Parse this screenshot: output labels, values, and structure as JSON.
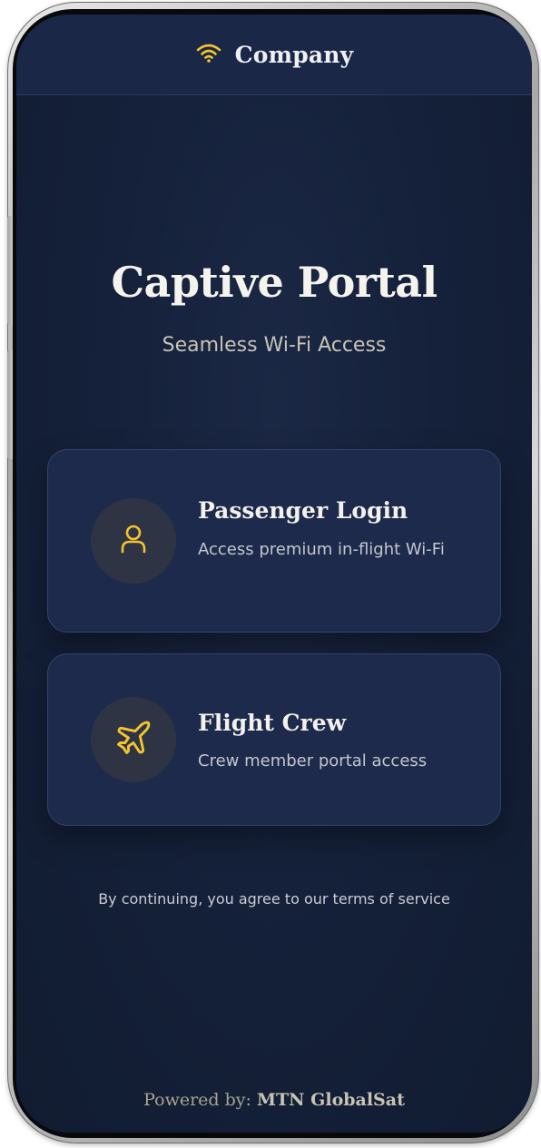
{
  "header": {
    "brand": "Company",
    "icon": "wifi-icon"
  },
  "hero": {
    "title": "Captive Portal",
    "subtitle": "Seamless Wi-Fi Access"
  },
  "options": [
    {
      "title": "Passenger Login",
      "description": "Access premium in-flight Wi-Fi",
      "icon": "user-icon"
    },
    {
      "title": "Flight Crew",
      "description": "Crew member portal access",
      "icon": "airplane-icon"
    }
  ],
  "terms": "By continuing, you agree to our terms of service",
  "footer": {
    "prefix": "Powered by:",
    "provider": "MTN GlobalSat"
  },
  "colors": {
    "accent": "#f4c430",
    "background": "#15213a",
    "card": "#1d2a4b"
  }
}
